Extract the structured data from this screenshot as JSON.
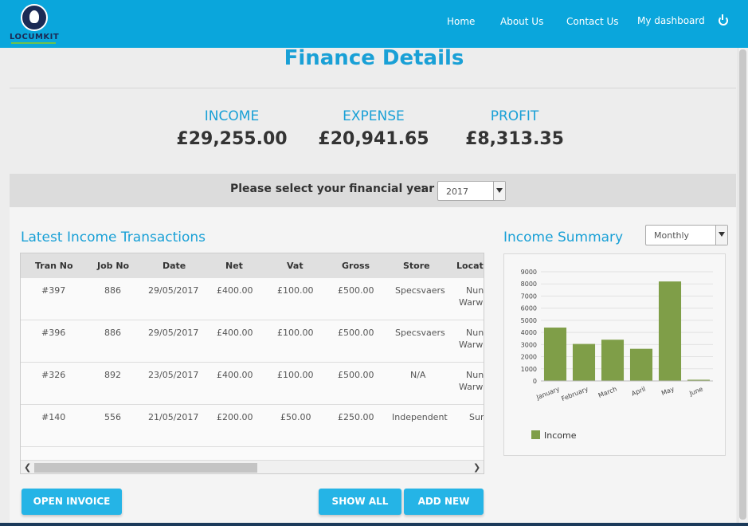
{
  "nav": {
    "logo_text": "LOCUMKIT",
    "links": [
      "Home",
      "About Us",
      "Contact Us",
      "My dashboard"
    ]
  },
  "page_title": "Finance Details",
  "summary": {
    "income_label": "INCOME",
    "income_value": "£29,255.00",
    "expense_label": "EXPENSE",
    "expense_value": "£20,941.65",
    "profit_label": "PROFIT",
    "profit_value": "£8,313.35"
  },
  "year_select": {
    "label": "Please select your financial year",
    "separator": ":",
    "value": "2017"
  },
  "transactions": {
    "title": "Latest Income Transactions",
    "columns": [
      "Tran No",
      "Job No",
      "Date",
      "Net",
      "Vat",
      "Gross",
      "Store",
      "Location"
    ],
    "rows": [
      [
        "#397",
        "886",
        "29/05/2017",
        "£400.00",
        "£100.00",
        "£500.00",
        "Specsvaers",
        "Nun",
        "Warwi"
      ],
      [
        "#396",
        "886",
        "29/05/2017",
        "£400.00",
        "£100.00",
        "£500.00",
        "Specsvaers",
        "Nun",
        "Warwi"
      ],
      [
        "#326",
        "892",
        "23/05/2017",
        "£400.00",
        "£100.00",
        "£500.00",
        "N/A",
        "Nun",
        "Warwi"
      ],
      [
        "#140",
        "556",
        "21/05/2017",
        "£200.00",
        "£50.00",
        "£250.00",
        "Independent",
        "Sur",
        ""
      ]
    ]
  },
  "income_summary": {
    "title": "Income Summary",
    "period_value": "Monthly",
    "legend_label": "Income"
  },
  "chart_data": {
    "type": "bar",
    "categories": [
      "January",
      "February",
      "March",
      "April",
      "May",
      "June"
    ],
    "series": [
      {
        "name": "Income",
        "values": [
          4400,
          3050,
          3400,
          2650,
          8200,
          100
        ]
      }
    ],
    "y_ticks": [
      0,
      1000,
      2000,
      3000,
      4000,
      5000,
      6000,
      7000,
      8000,
      9000
    ],
    "ylim": [
      0,
      9000
    ],
    "grid": true,
    "legend": "bottom-left",
    "color": "#7f9e48"
  },
  "buttons": {
    "open_invoice": "OPEN INVOICE",
    "show_all": "SHOW ALL",
    "add_new": "ADD NEW"
  },
  "colors": {
    "header": "#0aa6dc",
    "accent": "#19a0d6",
    "button": "#25b4e6",
    "bar": "#7f9e48"
  }
}
